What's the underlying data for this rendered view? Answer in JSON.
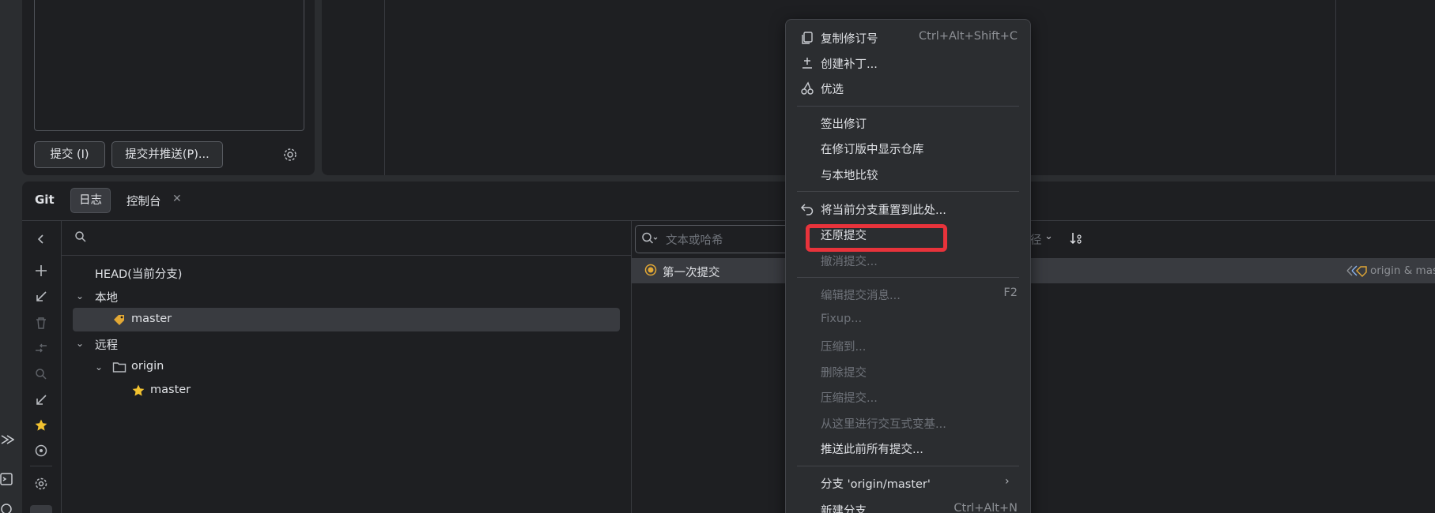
{
  "commit_panel": {
    "commit_button": "提交 (I)",
    "commit_push_button": "提交并推送(P)..."
  },
  "git_panel": {
    "title": "Git",
    "tabs": [
      {
        "label": "日志"
      },
      {
        "label": "控制台"
      }
    ],
    "close_glyph": "✕"
  },
  "branches": {
    "head": "HEAD(当前分支)",
    "local_label": "本地",
    "local_master": "master",
    "remote_label": "远程",
    "origin": "origin",
    "origin_master": "master"
  },
  "log": {
    "search_placeholder": "文本或哈希",
    "partial_filter": "径",
    "commit_message": "第一次提交",
    "refs": "origin & mast"
  },
  "context_menu": {
    "copy_revision": "复制修订号",
    "copy_revision_shortcut": "Ctrl+Alt+Shift+C",
    "create_patch": "创建补丁...",
    "cherry_pick": "优选",
    "checkout_revision": "签出修订",
    "show_repo_at_revision": "在修订版中显示仓库",
    "compare_with_local": "与本地比较",
    "reset_branch": "将当前分支重置到此处...",
    "revert_commit": "还原提交",
    "undo_commit": "撤消提交...",
    "edit_message": "编辑提交消息...",
    "edit_message_shortcut": "F2",
    "fixup": "Fixup...",
    "squash_into": "压缩到...",
    "drop_commit": "删除提交",
    "squash_commits": "压缩提交...",
    "interactive_rebase": "从这里进行交互式变基...",
    "push_all_before": "推送此前所有提交...",
    "branch_submenu": "分支 'origin/master'",
    "new_branch": "新建分支...",
    "new_branch_shortcut": "Ctrl+Alt+N"
  },
  "colors": {
    "highlight": "#e8333b",
    "tag": "#e2a835",
    "star": "#f2c230"
  }
}
